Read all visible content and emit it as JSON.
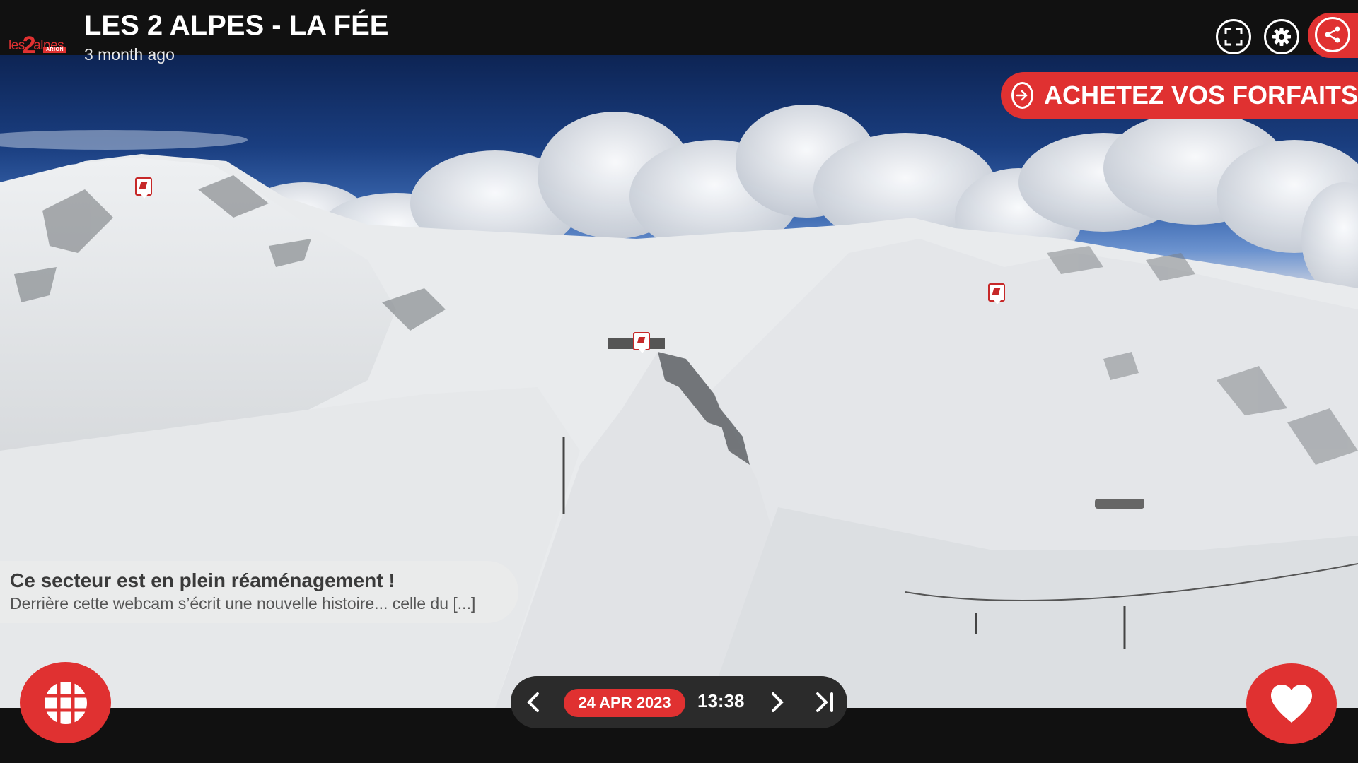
{
  "header": {
    "logo": {
      "prefix": "les",
      "number": "2",
      "name": "alpes",
      "sub": "ARION"
    },
    "title": "LES 2 ALPES - LA FÉE",
    "time_ago": "3 month ago",
    "buttons": [
      "fullscreen-icon",
      "gear-icon",
      "share-icon"
    ]
  },
  "cta": {
    "label": "ACHETEZ VOS FORFAITS",
    "icon": "arrow-right-circle-icon"
  },
  "info": {
    "title": "Ce secteur est en plein réaménagement !",
    "text": "Derrière cette webcam s’écrit une nouvelle histoire... celle du [...]"
  },
  "timeline": {
    "date": "24 APR 2023",
    "time": "13:38",
    "icons": [
      "chevron-left-icon",
      "chevron-right-icon",
      "skip-to-latest-icon"
    ]
  },
  "bottom": {
    "grid_icon": "grid-icon",
    "favorite_icon": "heart-icon"
  },
  "colors": {
    "accent": "#e03131",
    "bar": "#111111",
    "timeline_bg": "#2b2b2b"
  }
}
